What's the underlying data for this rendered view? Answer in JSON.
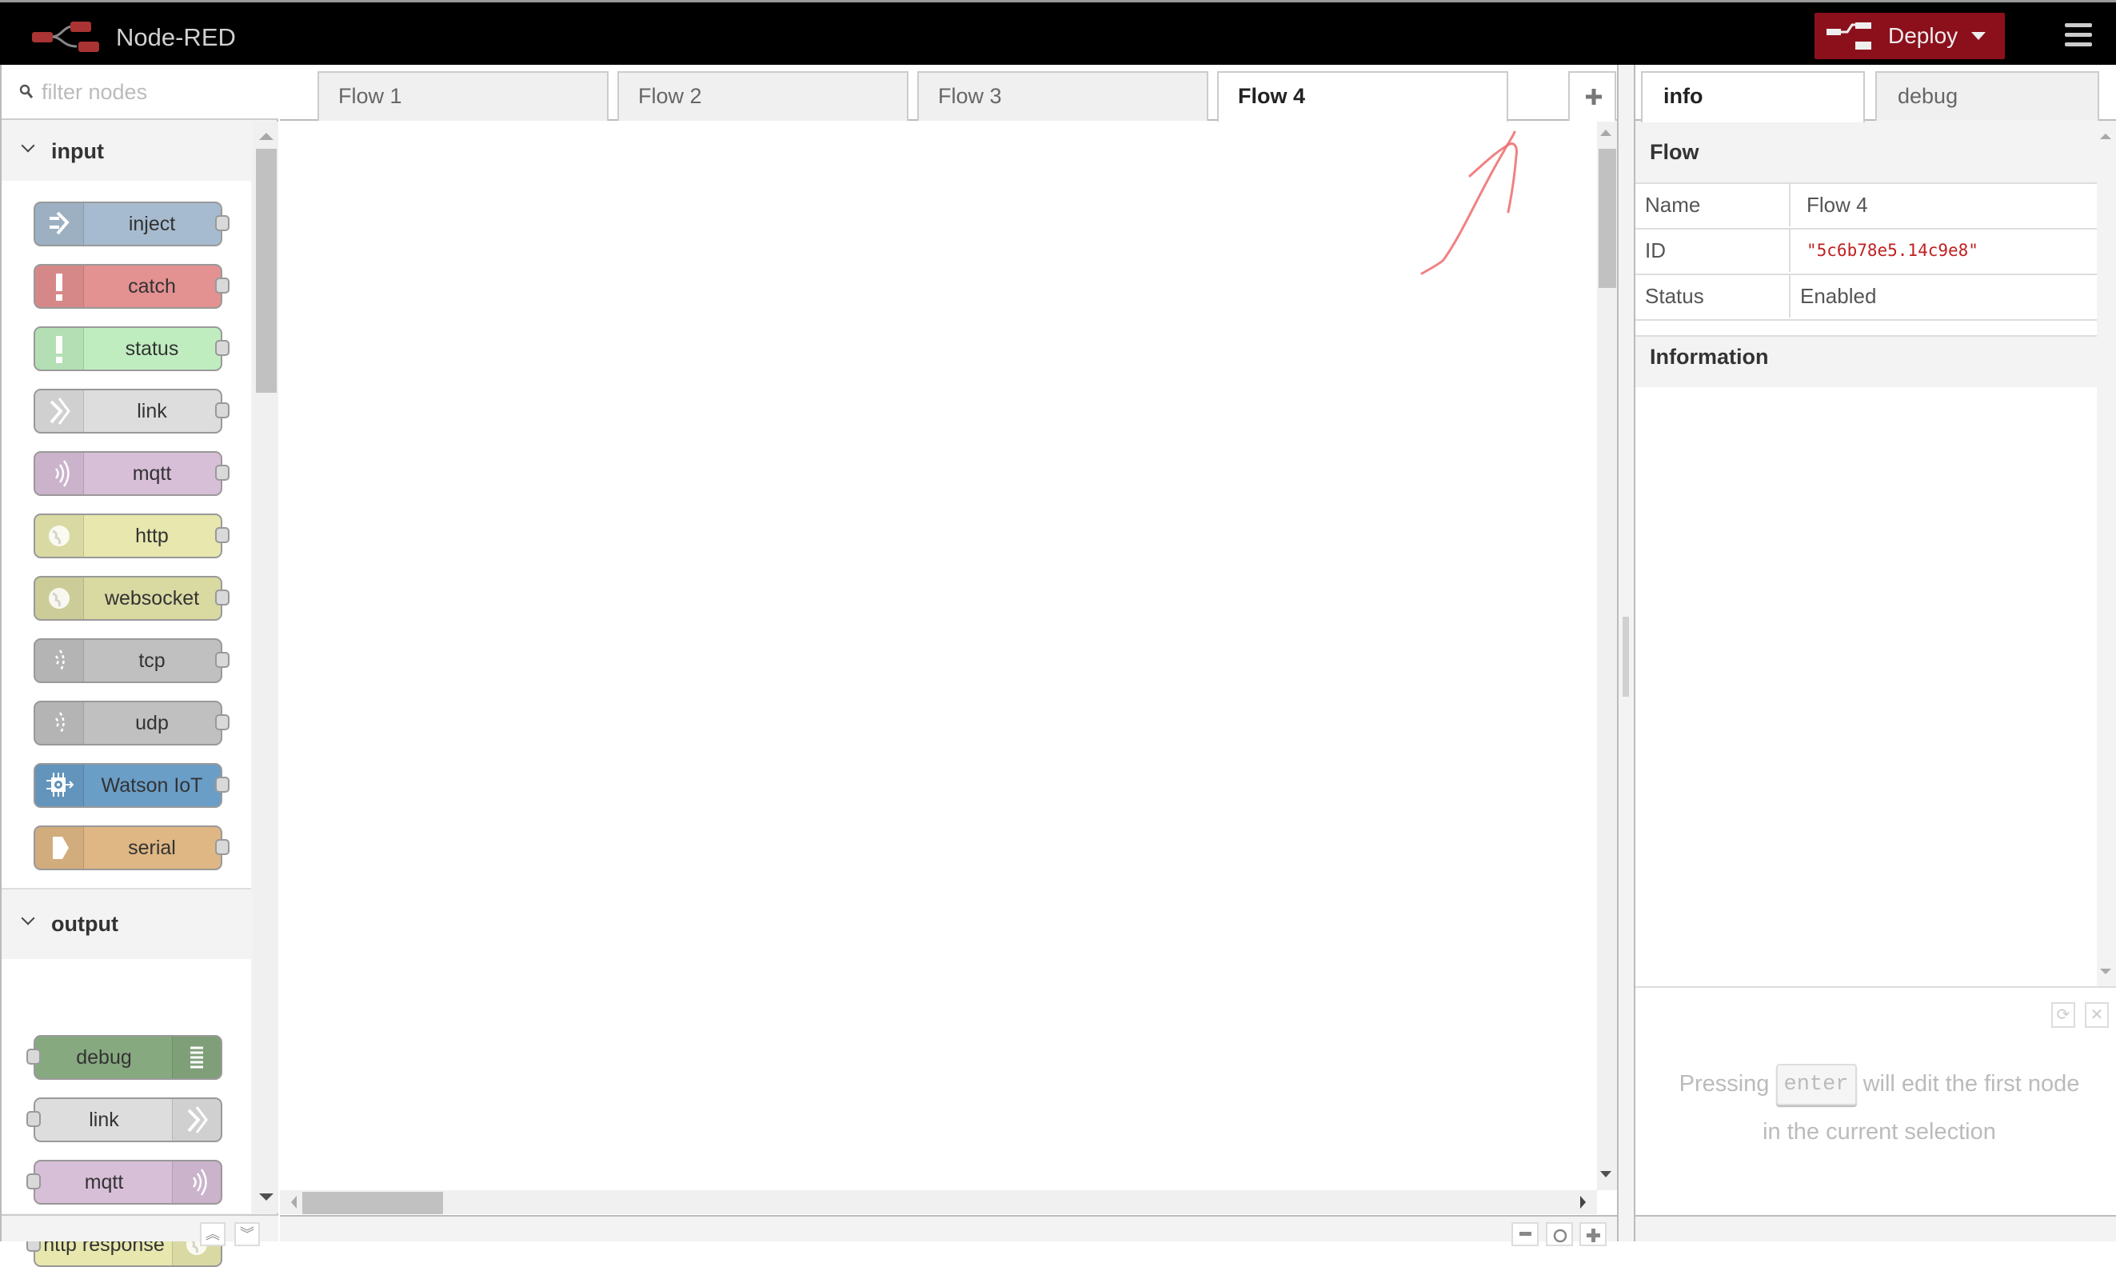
{
  "header": {
    "title": "Node-RED",
    "deploy_label": "Deploy",
    "colors": {
      "bar": "#000000",
      "deploy": "#8c101c"
    }
  },
  "palette": {
    "filter_placeholder": "filter nodes",
    "categories": [
      {
        "label": "input",
        "nodes": [
          {
            "label": "inject",
            "color": "#a6bbcf",
            "icon": "inject-arrow-icon"
          },
          {
            "label": "catch",
            "color": "#e49191",
            "icon": "alert-icon"
          },
          {
            "label": "status",
            "color": "#c0edc0",
            "icon": "alert-icon"
          },
          {
            "label": "link",
            "color": "#dddddd",
            "icon": "link-in-icon"
          },
          {
            "label": "mqtt",
            "color": "#d8bfd8",
            "icon": "bridge-icon"
          },
          {
            "label": "http",
            "color": "#e7e7ae",
            "icon": "globe-icon"
          },
          {
            "label": "websocket",
            "color": "#d9d9a2",
            "icon": "globe-icon"
          },
          {
            "label": "tcp",
            "color": "#c0c0c0",
            "icon": "bridge-dash-icon"
          },
          {
            "label": "udp",
            "color": "#c0c0c0",
            "icon": "bridge-dash-icon"
          },
          {
            "label": "Watson IoT",
            "color": "#6a9ec7",
            "icon": "iot-chip-icon"
          },
          {
            "label": "serial",
            "color": "#dfb784",
            "icon": "serial-arrow-icon"
          }
        ]
      },
      {
        "label": "output",
        "nodes": [
          {
            "label": "debug",
            "color": "#87a980",
            "icon": "debug-list-icon"
          },
          {
            "label": "link",
            "color": "#dddddd",
            "icon": "link-out-icon"
          },
          {
            "label": "mqtt",
            "color": "#d8bfd8",
            "icon": "bridge-icon"
          },
          {
            "label": "http response",
            "color": "#e7e7ae",
            "icon": "globe-icon"
          }
        ]
      }
    ]
  },
  "workspace": {
    "tabs": [
      {
        "label": "Flow 1",
        "active": false
      },
      {
        "label": "Flow 2",
        "active": false
      },
      {
        "label": "Flow 3",
        "active": false
      },
      {
        "label": "Flow 4",
        "active": true
      }
    ],
    "add_tab_label": "+"
  },
  "sidebar": {
    "tabs": [
      {
        "label": "info",
        "active": true
      },
      {
        "label": "debug",
        "active": false
      }
    ],
    "flow_section": "Flow",
    "properties": [
      {
        "key": "Name",
        "value": "Flow 4"
      },
      {
        "key": "ID",
        "value": "\"5c6b78e5.14c9e8\""
      },
      {
        "key": "Status",
        "value": "Enabled"
      }
    ],
    "information_section": "Information",
    "tip": {
      "before": "Pressing",
      "key": "enter",
      "after": "will edit the first node in the current selection"
    }
  },
  "annotation": {
    "type": "hand-drawn-arrow",
    "color": "#ee6b6b",
    "points_to": "add-flow-tab-button"
  }
}
